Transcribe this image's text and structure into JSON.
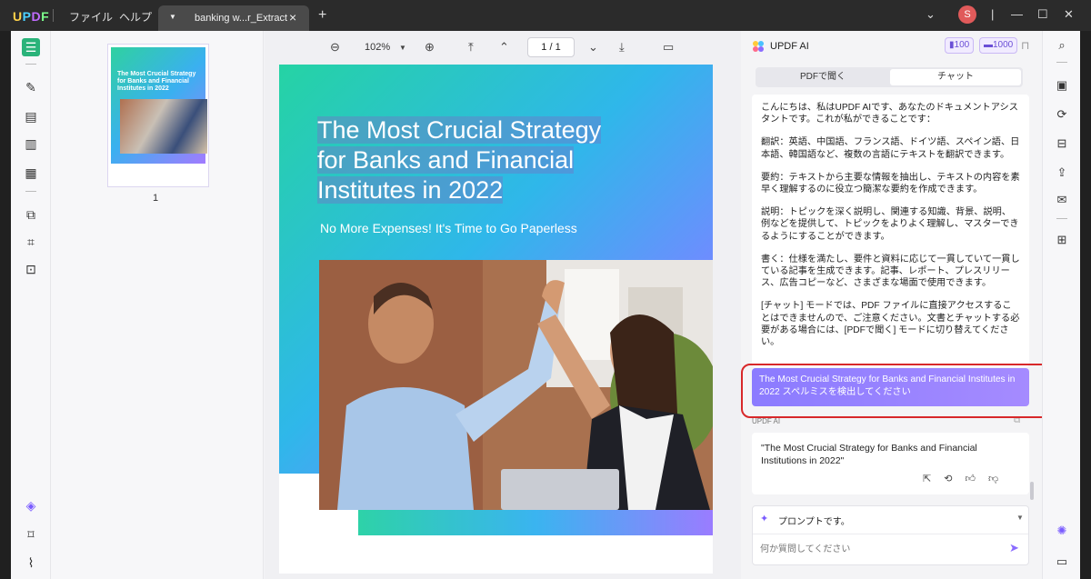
{
  "app": {
    "brand": [
      "U",
      "P",
      "D",
      "F"
    ],
    "menus": [
      "ファイル",
      "ヘルプ"
    ],
    "tab_title": "banking w...r_Extract",
    "user_initial": "S"
  },
  "viewer": {
    "zoom": "102%",
    "page_indicator": "1  /  1",
    "thumbnail_page": "1"
  },
  "pdf": {
    "title_lines": [
      "The Most Crucial Strategy",
      "for Banks and Financial",
      "Institutes in 2022"
    ],
    "subtitle": "No More Expenses! It's Time to Go Paperless",
    "thumb_title": "The Most Crucial Strategy for Banks and Financial Institutes in 2022"
  },
  "ai": {
    "title": "UPDF AI",
    "credits": [
      "100",
      "1000"
    ],
    "tabs": [
      "PDFで聞く",
      "チャット"
    ],
    "intro_paragraphs": [
      "こんにちは、私はUPDF AIです、あなたのドキュメントアシスタントです。これが私ができることです：",
      "翻訳：英語、中国語、フランス語、ドイツ語、スペイン語、日本語、韓国語など、複数の言語にテキストを翻訳できます。",
      "要約：テキストから主要な情報を抽出し、テキストの内容を素早く理解するのに役立つ簡潔な要約を作成できます。",
      "説明：トピックを深く説明し、関連する知識、背景、説明、例などを提供して、トピックをよりよく理解し、マスターできるようにすることができます。",
      "書く：仕様を満たし、要件と資料に応じて一貫していて一貫している記事を生成できます。記事、レポート、プレスリリース、広告コピーなど、さまざまな場面で使用できます。",
      " [チャット] モードでは、PDF ファイルに直接アクセスすることはできませんので、ご注意ください。文書とチャットする必要がある場合には、[PDFで聞く] モードに切り替えてください。"
    ],
    "user_message": "The Most Crucial Strategy for Banks and Financial Institutes in 2022 スペルミスを検出してください",
    "response_label": "UPDF AI",
    "response": "\"The Most Crucial Strategy for Banks and Financial Institutions in 2022\"",
    "prompt_label": "プロンプトです。",
    "input_placeholder": "何か質問してください"
  }
}
